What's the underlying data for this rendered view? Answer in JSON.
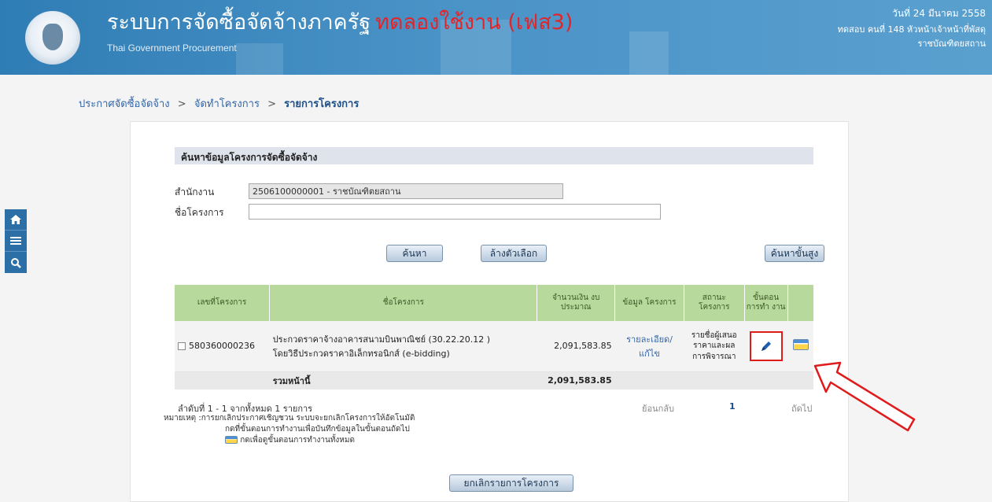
{
  "header": {
    "title": "ระบบการจัดซื้อจัดจ้างภาครัฐ",
    "title_trial": "ทดลองใช้งาน (เฟส3)",
    "subtitle": "Thai Government Procurement",
    "date": "วันที่ 24 มีนาคม 2558",
    "user_info": "ทดสอบ คนที่ 148  หัวหน้าเจ้าหน้าที่พัสดุ",
    "org": "ราชบัณฑิตยสถาน"
  },
  "breadcrumb": {
    "item1": "ประกาศจัดซื้อจัดจ้าง",
    "item2": "จัดทำโครงการ",
    "item3": "รายการโครงการ",
    "sep": ">"
  },
  "sidebar": {
    "icons": [
      "home-icon",
      "menu-icon",
      "search-icon"
    ]
  },
  "search": {
    "section_title": "ค้นหาข้อมูลโครงการจัดซื้อจัดจ้าง",
    "dept_label": "สำนักงาน",
    "dept_value": "2506100000001 - ราชบัณฑิตยสถาน",
    "project_label": "ชื่อโครงการ",
    "project_value": "",
    "search_button": "ค้นหา",
    "clear_button": "ล้างตัวเลือก",
    "advanced_button": "ค้นหาขั้นสูง"
  },
  "table": {
    "headers": {
      "project_no": "เลขที่โครงการ",
      "project_name": "ชื่อโครงการ",
      "budget": "จำนวนเงิน งบประมาณ",
      "project_info": "ข้อมูล โครงการ",
      "status": "สถานะ โครงการ",
      "step": "ขั้นตอน การทำ งาน"
    },
    "row": {
      "project_no": "580360000236",
      "name_line1": "ประกวดราคาจ้างอาคารสนามบินพาณิชย์ (30.22.20.12 )",
      "name_line2": "โดยวิธีประกวดราคาอิเล็กทรอนิกส์ (e-bidding)",
      "budget": "2,091,583.85",
      "info_line1": "รายละเอียด/",
      "info_line2": "แก้ไข",
      "status_line1": "รายชื่อผู้เสนอ",
      "status_line2": "ราคาและผล",
      "status_line3": "การพิจารณา"
    },
    "summary": {
      "label": "รวมหน้านี้",
      "total": "2,091,583.85"
    }
  },
  "pager": {
    "range": "ลำดับที่ 1 - 1 จากทั้งหมด 1 รายการ",
    "prev": "ย้อนกลับ",
    "page": "1",
    "next": "ถัดไป"
  },
  "notes": {
    "line1": "หมายเหตุ :การยกเลิกประกาศเชิญชวน ระบบจะยกเลิกโครงการให้อัตโนมัติ",
    "line2": "กดที่ขั้นตอนการทำงานเพื่อบันทึกข้อมูลในขั้นตอนถัดไป",
    "line3": "กดเพื่อดูขั้นตอนการทำงานทั้งหมด"
  },
  "cancel_button": "ยกเลิกรายการโครงการ",
  "colors": {
    "header_bg": "#3a86bd",
    "trial_text": "#e0262b",
    "table_header_bg": "#b7d99b",
    "highlight": "#e01b1b"
  }
}
